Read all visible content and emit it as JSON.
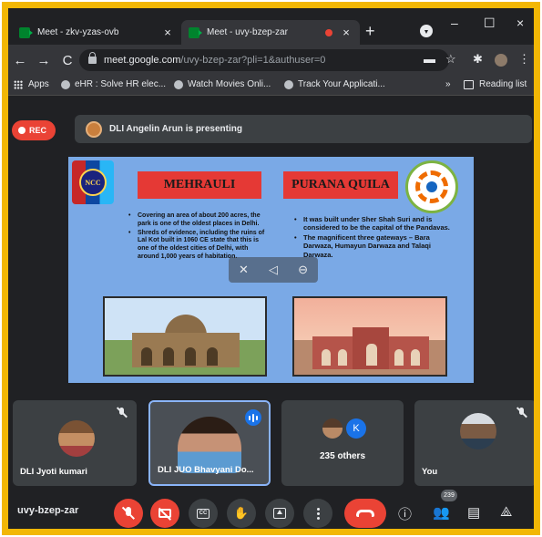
{
  "browser": {
    "tabs": [
      {
        "title": "Meet - zkv-yzas-ovb",
        "close": "×"
      },
      {
        "title": "Meet - uvy-bzep-zar",
        "close": "×"
      }
    ],
    "new_tab": "+",
    "window_controls": {
      "minimize": "–",
      "maximize": "☐",
      "close": "×"
    },
    "nav": {
      "back": "←",
      "forward": "→",
      "reload": "C"
    },
    "url_host": "meet.google.com",
    "url_path": "/uvy-bzep-zar?pli=1&authuser=0",
    "bookmarks": [
      "Apps",
      "eHR : Solve HR elec...",
      "Watch Movies Onli...",
      "Track Your Applicati..."
    ],
    "bookmarks_overflow": "»",
    "reading_list": "Reading list"
  },
  "meet": {
    "rec_label": "REC",
    "presenting_text": "DLI Angelin Arun is presenting",
    "slide": {
      "logo_text": "NCC",
      "title_left": "MEHRAULI",
      "title_right": "PURANA QUILA",
      "bullets_left": [
        "Covering an area of about 200 acres, the park is one of the oldest places in Delhi.",
        "Shreds of evidence, including the ruins of Lal Kot built in 1060 CE state that this is one of the oldest cities of Delhi, with around 1,000 years of habitation."
      ],
      "bullets_right": [
        "It was built under Sher Shah Suri and is considered to be the capital of the Pandavas.",
        "The magnificent three gateways – Bara Darwaza, Humayun Darwaza and Talaqi Darwaza."
      ]
    },
    "tiles": [
      {
        "name": "DLI Jyoti kumari"
      },
      {
        "name": "DLI JUO Bhavyani Do..."
      },
      {
        "others_initial": "K",
        "others_label": "235 others"
      },
      {
        "name": "You"
      }
    ],
    "meeting_code": "uvy-bzep-zar",
    "participant_count": "239",
    "colors": {
      "accent_red": "#ea4335",
      "accent_blue": "#1a73e8",
      "frame_yellow": "#f2b705",
      "bg": "#202124"
    }
  }
}
